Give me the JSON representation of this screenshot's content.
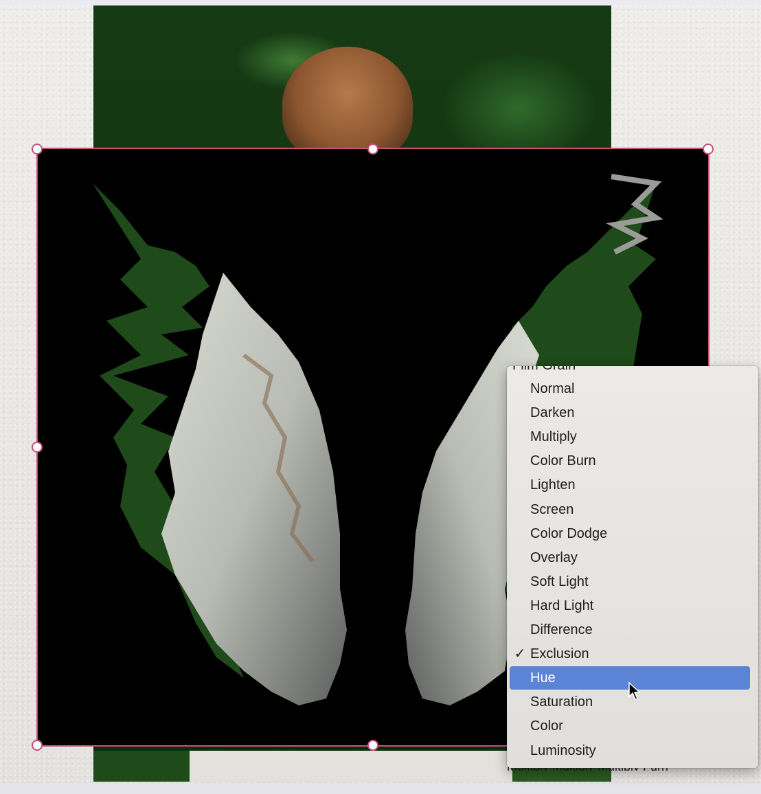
{
  "canvas": {
    "accent_color": "#c8507a",
    "highlight_color": "#5b83d6"
  },
  "blend_menu": {
    "clipped_header": "Film Grain",
    "items": [
      {
        "label": "Normal",
        "checked": false,
        "highlighted": false
      },
      {
        "label": "Darken",
        "checked": false,
        "highlighted": false
      },
      {
        "label": "Multiply",
        "checked": false,
        "highlighted": false
      },
      {
        "label": "Color Burn",
        "checked": false,
        "highlighted": false
      },
      {
        "label": "Lighten",
        "checked": false,
        "highlighted": false
      },
      {
        "label": "Screen",
        "checked": false,
        "highlighted": false
      },
      {
        "label": "Color Dodge",
        "checked": false,
        "highlighted": false
      },
      {
        "label": "Overlay",
        "checked": false,
        "highlighted": false
      },
      {
        "label": "Soft Light",
        "checked": false,
        "highlighted": false
      },
      {
        "label": "Hard Light",
        "checked": false,
        "highlighted": false
      },
      {
        "label": "Difference",
        "checked": false,
        "highlighted": false
      },
      {
        "label": "Exclusion",
        "checked": true,
        "highlighted": false
      },
      {
        "label": "Hue",
        "checked": false,
        "highlighted": true
      },
      {
        "label": "Saturation",
        "checked": false,
        "highlighted": false
      },
      {
        "label": "Color",
        "checked": false,
        "highlighted": false
      },
      {
        "label": "Luminosity",
        "checked": false,
        "highlighted": false
      }
    ],
    "check_glyph": "✓",
    "under_clip_text": "Multiply   Multiply   Multiply   Furn"
  }
}
